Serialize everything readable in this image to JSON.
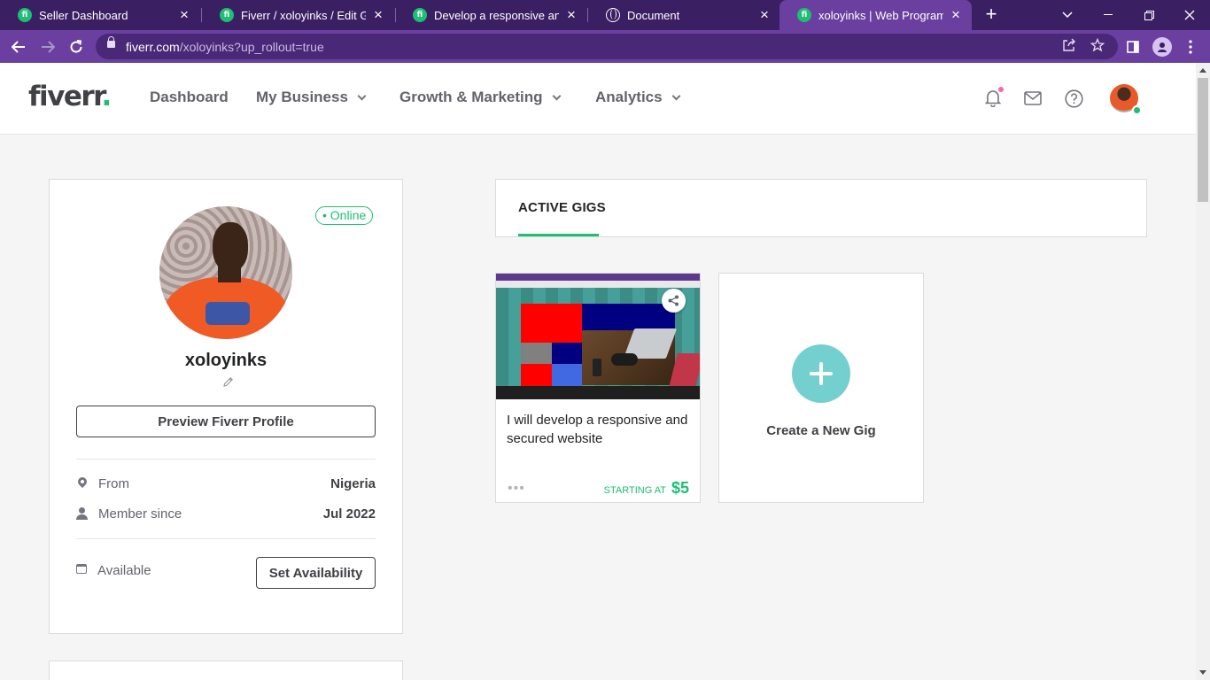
{
  "browser": {
    "tabs": [
      {
        "title": "Seller Dashboard",
        "favicon": "fiverr-icon",
        "active": false
      },
      {
        "title": "Fiverr / xoloyinks / Edit Gig",
        "favicon": "fiverr-icon",
        "active": false
      },
      {
        "title": "Develop a responsive and se",
        "favicon": "fiverr-icon",
        "active": false
      },
      {
        "title": "Document",
        "favicon": "globe-icon",
        "active": false
      },
      {
        "title": "xoloyinks | Web Programmin",
        "favicon": "fiverr-icon",
        "active": true
      }
    ],
    "favicon_letter": "fi",
    "close_glyph": "×",
    "new_tab_glyph": "+",
    "url_host": "fiverr.com",
    "url_path": "/xoloyinks?up_rollout=true",
    "colors": {
      "tabbar": "#3b1f63",
      "toolbar": "#6b3fa0",
      "omnibox": "#4a2878"
    }
  },
  "site": {
    "logo_text": "fiverr",
    "logo_dot": ".",
    "nav": [
      {
        "label": "Dashboard",
        "has_dropdown": false
      },
      {
        "label": "My Business",
        "has_dropdown": true
      },
      {
        "label": "Growth & Marketing",
        "has_dropdown": true
      },
      {
        "label": "Analytics",
        "has_dropdown": true
      }
    ],
    "header_icons": [
      "bell-icon",
      "envelope-icon",
      "help-icon",
      "user-avatar"
    ],
    "brand_color": "#1dbf73"
  },
  "profile": {
    "status": "• Online",
    "username": "xoloyinks",
    "preview_button": "Preview Fiverr Profile",
    "from_label": "From",
    "from_value": "Nigeria",
    "member_label": "Member since",
    "member_value": "Jul 2022",
    "availability_label": "Available",
    "availability_button": "Set Availability"
  },
  "gigs": {
    "tab_label": "ACTIVE GIGS",
    "items": [
      {
        "title": "I will develop a responsive and secured website",
        "starting_label": "STARTING AT",
        "price": "$5"
      }
    ],
    "create_label": "Create a New Gig"
  }
}
